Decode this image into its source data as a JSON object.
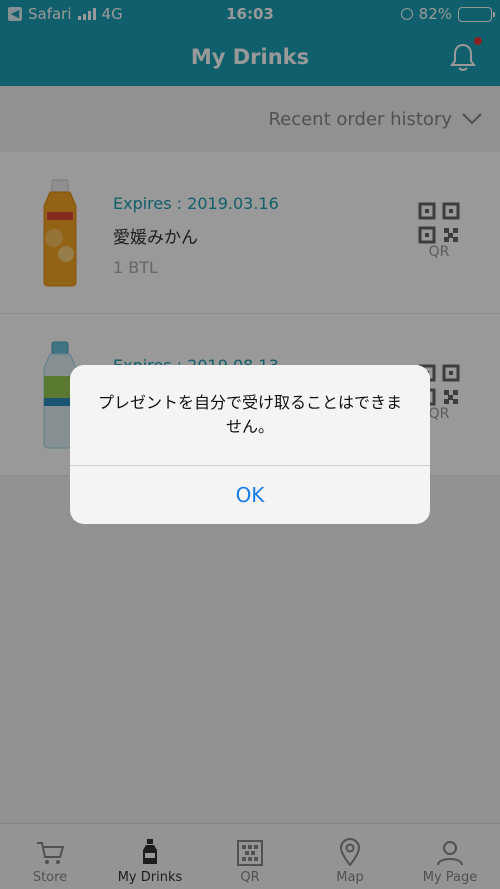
{
  "status_bar": {
    "carrier": "Safari",
    "network": "4G",
    "time": "16:03",
    "battery": "82%",
    "battery_level": 0.82
  },
  "header": {
    "title": "My Drinks",
    "notification_icon": "bell-icon",
    "notification_dot_color": "#e53935"
  },
  "filter": {
    "label": "Recent order history"
  },
  "drinks": [
    {
      "expires": "Expires : 2019.03.16",
      "name": "愛媛みかん",
      "quantity": "1 BTL",
      "qr_label": "QR",
      "bottle_color": "#f5a623"
    },
    {
      "expires": "Expires : 2019.08.13",
      "name": "",
      "quantity": "",
      "qr_label": "QR",
      "bottle_color": "#9fd8e8"
    }
  ],
  "tabs": [
    {
      "label": "Store",
      "icon": "cart-icon",
      "active": false
    },
    {
      "label": "My Drinks",
      "icon": "bottle-icon",
      "active": true
    },
    {
      "label": "QR",
      "icon": "qr-icon",
      "active": false
    },
    {
      "label": "Map",
      "icon": "map-pin-icon",
      "active": false
    },
    {
      "label": "My Page",
      "icon": "person-icon",
      "active": false
    }
  ],
  "alert": {
    "message": "プレゼントを自分で受け取ることはできません。",
    "ok_label": "OK"
  },
  "colors": {
    "accent": "#1c9fb5",
    "link": "#1a7de6"
  }
}
